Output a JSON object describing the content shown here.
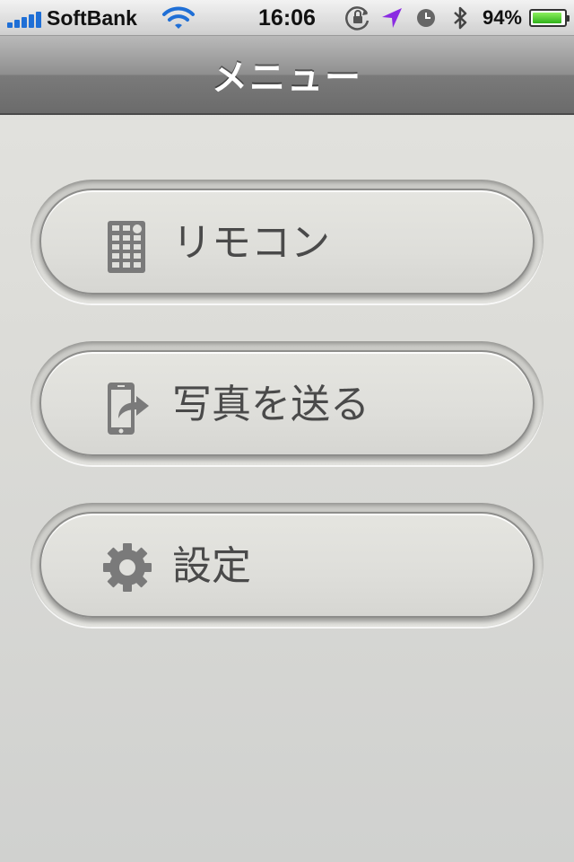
{
  "status_bar": {
    "carrier": "SoftBank",
    "time": "16:06",
    "battery_percent": "94%",
    "battery_level": 0.94,
    "icons": [
      "signal-icon",
      "wifi-icon",
      "orientation-lock-icon",
      "location-arrow-icon",
      "alarm-clock-icon",
      "bluetooth-icon",
      "battery-icon"
    ]
  },
  "nav": {
    "title": "メニュー"
  },
  "menu": {
    "items": [
      {
        "label": "リモコン",
        "icon": "remote-control-icon"
      },
      {
        "label": "写真を送る",
        "icon": "send-photo-icon"
      },
      {
        "label": "設定",
        "icon": "gear-icon"
      }
    ]
  },
  "colors": {
    "nav_gradient_top": "#b9b9b9",
    "nav_gradient_bottom": "#6b6b6b",
    "button_text": "#4a4a4a",
    "icon_gray": "#7a7a7a",
    "location_arrow": "#8a2be2",
    "battery_green": "#2fb21a"
  }
}
